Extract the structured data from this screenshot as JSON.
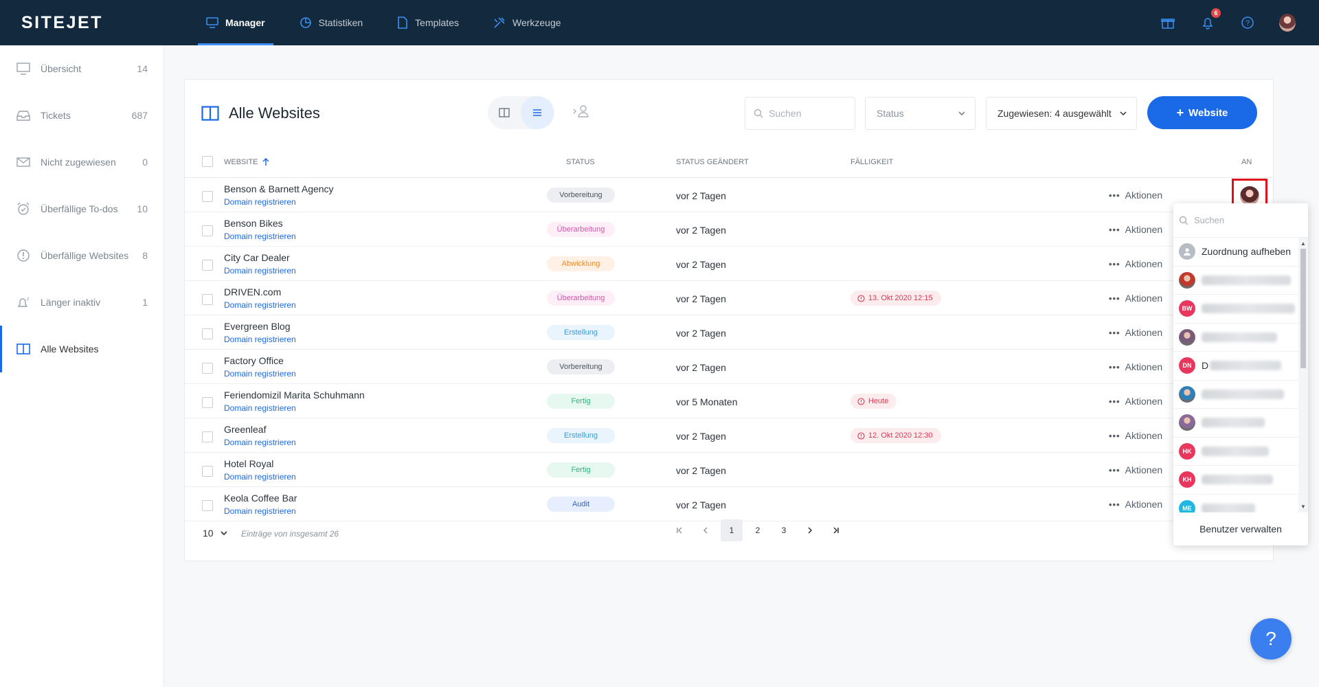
{
  "app": {
    "logo": "SITEJET"
  },
  "nav": {
    "items": [
      {
        "label": "Manager",
        "active": true,
        "icon": "monitor-icon"
      },
      {
        "label": "Statistiken",
        "active": false,
        "icon": "pie-chart-icon"
      },
      {
        "label": "Templates",
        "active": false,
        "icon": "file-icon"
      },
      {
        "label": "Werkzeuge",
        "active": false,
        "icon": "tools-icon"
      }
    ],
    "notifications_count": "6"
  },
  "sidebar": {
    "items": [
      {
        "label": "Übersicht",
        "count": "14",
        "icon": "monitor-icon"
      },
      {
        "label": "Tickets",
        "count": "687",
        "icon": "inbox-icon"
      },
      {
        "label": "Nicht zugewiesen",
        "count": "0",
        "icon": "envelope-icon"
      },
      {
        "label": "Überfällige To-dos",
        "count": "10",
        "icon": "alarm-icon"
      },
      {
        "label": "Überfällige Websites",
        "count": "8",
        "icon": "alert-circle-icon"
      },
      {
        "label": "Länger inaktiv",
        "count": "1",
        "icon": "bell-sleep-icon"
      },
      {
        "label": "Alle Websites",
        "count": "",
        "icon": "columns-icon",
        "active": true
      }
    ]
  },
  "main": {
    "title": "Alle Websites",
    "search_placeholder": "Suchen",
    "status_select": "Status",
    "assigned_select": "Zugewiesen: 4 ausgewählt",
    "add_button": "Website",
    "columns": {
      "website": "Website",
      "status": "Status",
      "changed": "Status geändert",
      "due": "Fälligkeit",
      "assigned": "An"
    },
    "rows": [
      {
        "name": "Benson & Barnett Agency",
        "domain": "Domain registrieren",
        "status": "Vorbereitung",
        "status_class": "b-vorbereitung",
        "changed": "vor 2 Tagen",
        "due": "",
        "actions": "Aktionen"
      },
      {
        "name": "Benson Bikes",
        "domain": "Domain registrieren",
        "status": "Überarbeitung",
        "status_class": "b-ueberarbeitung",
        "changed": "vor 2 Tagen",
        "due": "",
        "actions": "Aktionen"
      },
      {
        "name": "City Car Dealer",
        "domain": "Domain registrieren",
        "status": "Abwicklung",
        "status_class": "b-abwicklung",
        "changed": "vor 2 Tagen",
        "due": "",
        "actions": "Aktionen"
      },
      {
        "name": "DRIVEN.com",
        "domain": "Domain registrieren",
        "status": "Überarbeitung",
        "status_class": "b-ueberarbeitung",
        "changed": "vor 2 Tagen",
        "due": "13. Okt 2020 12:15",
        "actions": "Aktionen"
      },
      {
        "name": "Evergreen Blog",
        "domain": "Domain registrieren",
        "status": "Erstellung",
        "status_class": "b-erstellung",
        "changed": "vor 2 Tagen",
        "due": "",
        "actions": "Aktionen"
      },
      {
        "name": "Factory Office",
        "domain": "Domain registrieren",
        "status": "Vorbereitung",
        "status_class": "b-vorbereitung",
        "changed": "vor 2 Tagen",
        "due": "",
        "actions": "Aktionen"
      },
      {
        "name": "Feriendomizil Marita Schuhmann",
        "domain": "Domain registrieren",
        "status": "Fertig",
        "status_class": "b-fertig",
        "changed": "vor 5 Monaten",
        "due": "Heute",
        "actions": "Aktionen"
      },
      {
        "name": "Greenleaf",
        "domain": "Domain registrieren",
        "status": "Erstellung",
        "status_class": "b-erstellung",
        "changed": "vor 2 Tagen",
        "due": "12. Okt 2020 12:30",
        "actions": "Aktionen"
      },
      {
        "name": "Hotel Royal",
        "domain": "Domain registrieren",
        "status": "Fertig",
        "status_class": "b-fertig",
        "changed": "vor 2 Tagen",
        "due": "",
        "actions": "Aktionen"
      },
      {
        "name": "Keola Coffee Bar",
        "domain": "Domain registrieren",
        "status": "Audit",
        "status_class": "b-audit",
        "changed": "vor 2 Tagen",
        "due": "",
        "actions": "Aktionen"
      }
    ],
    "footer": {
      "per_page": "10",
      "total_text": "Einträge von insgesamt 26",
      "pages": [
        "1",
        "2",
        "3"
      ],
      "current_page": "1"
    }
  },
  "dropdown": {
    "search_placeholder": "Suchen",
    "unassign_label": "Zuordnung aufheben",
    "users": [
      {
        "initials": "",
        "color": "#c0392b",
        "photo": true
      },
      {
        "initials": "BW",
        "color": "#e8365d"
      },
      {
        "initials": "",
        "color": "#7a5a7a",
        "photo": true
      },
      {
        "initials": "DN",
        "color": "#e8365d",
        "partial_text": "D"
      },
      {
        "initials": "",
        "color": "#2f7fb8",
        "photo": true
      },
      {
        "initials": "",
        "color": "#8a6a9a",
        "photo": true
      },
      {
        "initials": "HK",
        "color": "#e8365d"
      },
      {
        "initials": "KH",
        "color": "#e8365d"
      },
      {
        "initials": "ME",
        "color": "#1fb8e0"
      }
    ],
    "footer_label": "Benutzer verwalten"
  },
  "help_fab": "?"
}
